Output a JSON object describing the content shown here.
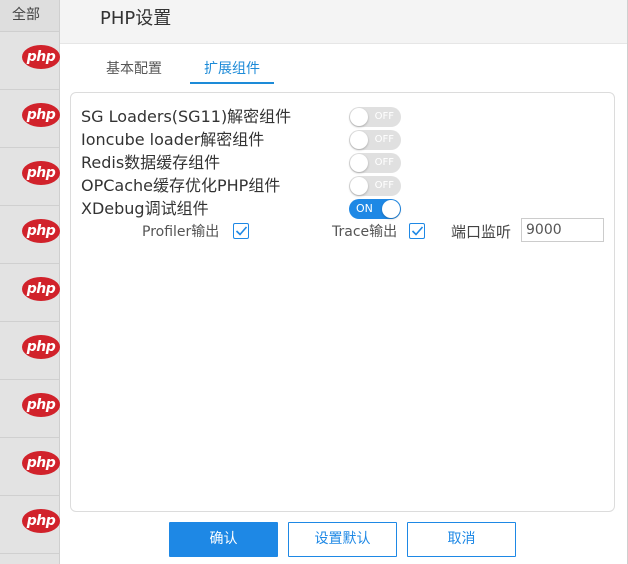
{
  "background": {
    "sidebar_header": "全部",
    "logo_text": "php",
    "logo_count": 9
  },
  "dialog": {
    "title": "PHP设置",
    "tabs": [
      {
        "label": "基本配置",
        "active": false
      },
      {
        "label": "扩展组件",
        "active": true
      }
    ],
    "options": [
      {
        "label": "SG Loaders(SG11)解密组件",
        "state": "OFF",
        "on": false
      },
      {
        "label": "Ioncube loader解密组件",
        "state": "OFF",
        "on": false
      },
      {
        "label": "Redis数据缓存组件",
        "state": "OFF",
        "on": false
      },
      {
        "label": "OPCache缓存优化PHP组件",
        "state": "OFF",
        "on": false
      },
      {
        "label": "XDebug调试组件",
        "state": "ON",
        "on": true
      }
    ],
    "xdebug": {
      "profiler_label": "Profiler输出",
      "profiler_checked": true,
      "trace_label": "Trace输出",
      "trace_checked": true,
      "port_label": "端口监听",
      "port_value": "9000"
    },
    "buttons": {
      "confirm": "确认",
      "set_default": "设置默认",
      "cancel": "取消"
    }
  },
  "colors": {
    "accent": "#1e88e5",
    "php_logo": "#d1222b",
    "toggle_off": "#e0e0e0"
  }
}
